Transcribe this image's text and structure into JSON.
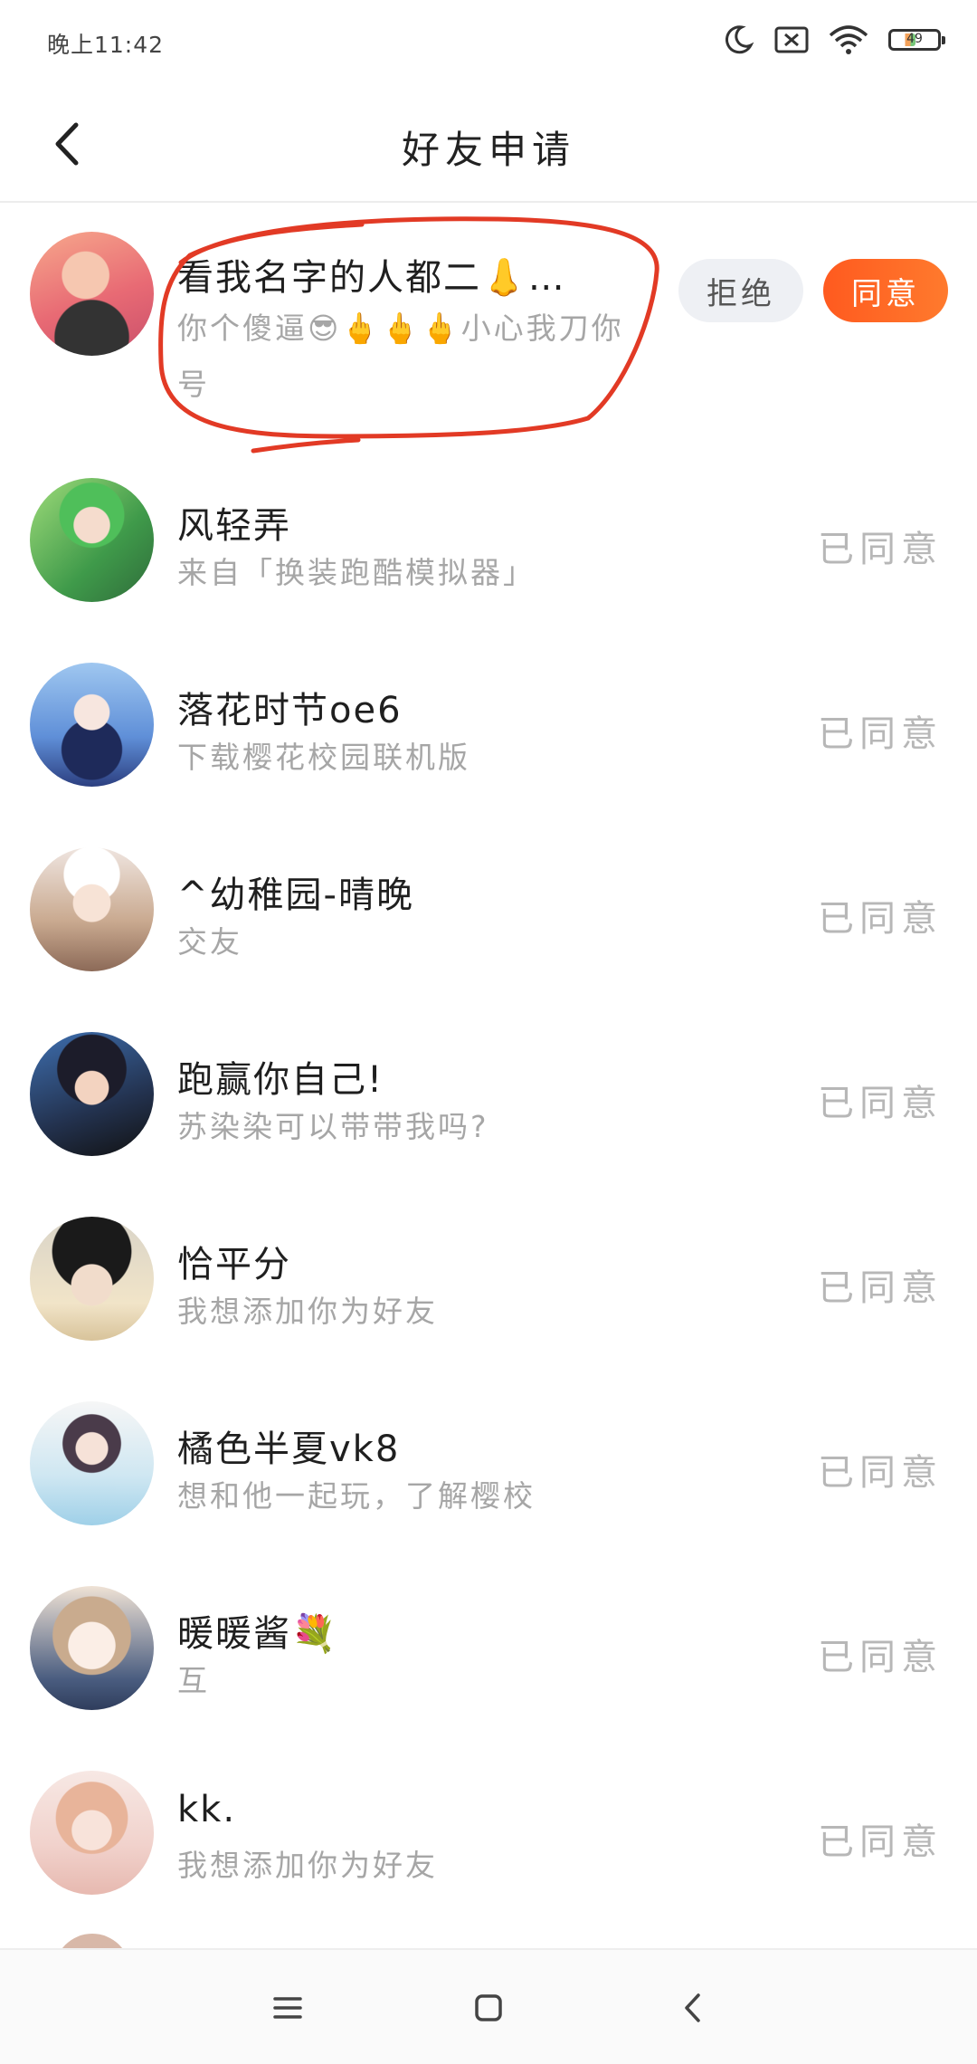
{
  "status_bar": {
    "time": "晚上11:42",
    "battery_level": "49",
    "icons": [
      "moon-icon",
      "sim-off-icon",
      "wifi-icon",
      "battery-icon"
    ]
  },
  "header": {
    "back_icon": "chevron-left-icon",
    "title": "好友申请"
  },
  "pending_request": {
    "name": "看我名字的人都二👃…",
    "message": "你个傻逼😎🖕🖕🖕小心我刀你号",
    "reject_label": "拒绝",
    "agree_label": "同意",
    "annotation": "red-hand-drawn-circle"
  },
  "requests": [
    {
      "name": "风轻弄",
      "message": "来自「换装跑酷模拟器」",
      "status": "已同意"
    },
    {
      "name": "落花时节oe6",
      "message": "下载樱花校园联机版",
      "status": "已同意"
    },
    {
      "name": "^幼稚园-晴晚",
      "message": "交友",
      "status": "已同意"
    },
    {
      "name": "跑赢你自己!",
      "message": "苏染染可以带带我吗?",
      "status": "已同意"
    },
    {
      "name": "恰平分",
      "message": "我想添加你为好友",
      "status": "已同意"
    },
    {
      "name": "橘色半夏vk8",
      "message": "想和他一起玩，了解樱校",
      "status": "已同意"
    },
    {
      "name": "暖暖酱💐",
      "message": "互",
      "status": "已同意"
    },
    {
      "name": "kk.",
      "message": "我想添加你为好友",
      "status": "已同意"
    }
  ],
  "colors": {
    "accent": "#ff6a22",
    "annotation": "#e23a25",
    "muted_text": "#a6a6a6",
    "agreed_text": "#b7b7b7"
  },
  "nav_bar": {
    "icons": [
      "menu-icon",
      "home-square-icon",
      "back-triangle-icon"
    ]
  }
}
